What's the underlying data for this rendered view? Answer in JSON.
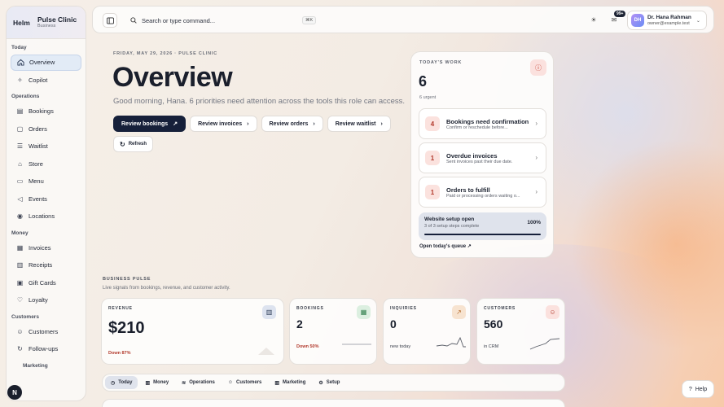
{
  "brand": {
    "logo": "Helm",
    "name": "Pulse Clinic",
    "plan": "Business"
  },
  "sidebar": {
    "groups": [
      {
        "label": "Today",
        "items": [
          {
            "label": "Overview",
            "icon": "home-icon",
            "active": true
          },
          {
            "label": "Copilot",
            "icon": "sparkle-icon"
          }
        ]
      },
      {
        "label": "Operations",
        "items": [
          {
            "label": "Bookings",
            "icon": "calendar-icon"
          },
          {
            "label": "Orders",
            "icon": "box-icon"
          },
          {
            "label": "Waitlist",
            "icon": "list-icon"
          },
          {
            "label": "Store",
            "icon": "store-icon"
          },
          {
            "label": "Menu",
            "icon": "book-icon"
          },
          {
            "label": "Events",
            "icon": "megaphone-icon"
          },
          {
            "label": "Locations",
            "icon": "pin-icon"
          }
        ]
      },
      {
        "label": "Money",
        "items": [
          {
            "label": "Invoices",
            "icon": "invoice-icon"
          },
          {
            "label": "Receipts",
            "icon": "receipt-icon"
          },
          {
            "label": "Gift Cards",
            "icon": "gift-icon"
          },
          {
            "label": "Loyalty",
            "icon": "heart-icon"
          }
        ]
      },
      {
        "label": "Customers",
        "items": [
          {
            "label": "Customers",
            "icon": "users-icon"
          },
          {
            "label": "Follow-ups",
            "icon": "refresh-icon"
          }
        ]
      },
      {
        "label": "Marketing",
        "items": []
      }
    ]
  },
  "topbar": {
    "search_placeholder": "Search or type command...",
    "shortcut": "⌘K",
    "notifications_badge": "99+",
    "user": {
      "name": "Dr. Hana Rahman",
      "email": "owner@example.test",
      "initials": "DH"
    }
  },
  "hero": {
    "eyebrow": "FRIDAY, MAY 29, 2026 · PULSE CLINIC",
    "title": "Overview",
    "subtitle": "Good morning, Hana. 6 priorities need attention across the tools this role can access.",
    "actions": [
      "Review bookings",
      "Review invoices",
      "Review orders",
      "Review waitlist"
    ],
    "refresh": "Refresh"
  },
  "work": {
    "label": "TODAY'S WORK",
    "count": "6",
    "urgent": "6 urgent",
    "tasks": [
      {
        "num": "4",
        "title": "Bookings need confirmation",
        "desc": "Confirm or reschedule before..."
      },
      {
        "num": "1",
        "title": "Overdue invoices",
        "desc": "Sent invoices past their due date."
      },
      {
        "num": "1",
        "title": "Orders to fulfill",
        "desc": "Paid or processing orders waiting o..."
      }
    ],
    "setup": {
      "title": "Website setup open",
      "sub": "3 of 3 setup steps complete",
      "pct": "100%",
      "progress": 1.0
    },
    "queue_link": "Open today's queue"
  },
  "pulse": {
    "label": "BUSINESS PULSE",
    "sub": "Live signals from bookings, revenue, and customer activity.",
    "cards": [
      {
        "label": "REVENUE",
        "value": "$210",
        "foot": "Down 87%",
        "icon": "chart-icon"
      },
      {
        "label": "BOOKINGS",
        "value": "2",
        "foot": "Down 50%",
        "icon": "calendar-icon"
      },
      {
        "label": "INQUIRIES",
        "value": "0",
        "foot": "new today",
        "icon": "trend-icon"
      },
      {
        "label": "CUSTOMERS",
        "value": "560",
        "foot": "in CRM",
        "icon": "users-icon"
      }
    ]
  },
  "tabs": [
    {
      "label": "Today",
      "active": true
    },
    {
      "label": "Money"
    },
    {
      "label": "Operations"
    },
    {
      "label": "Customers"
    },
    {
      "label": "Marketing"
    },
    {
      "label": "Setup"
    }
  ],
  "help": "Help",
  "n_badge": "N",
  "colors": {
    "primary": "#16203a",
    "danger": "#b2392c",
    "accent_bg": "#e2ebf6"
  }
}
